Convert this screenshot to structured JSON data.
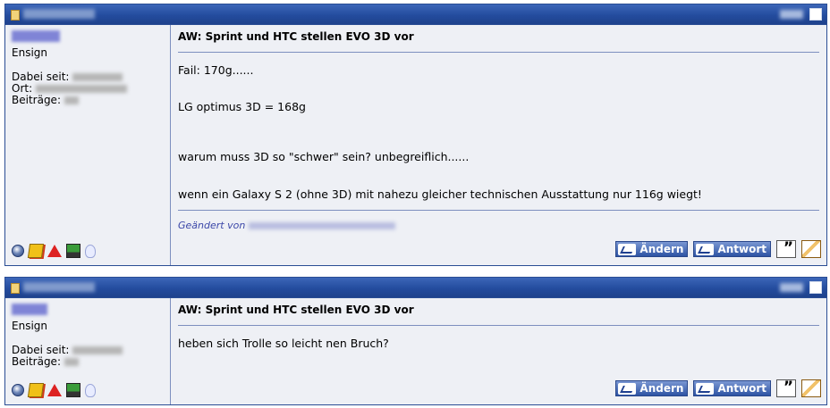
{
  "posts": [
    {
      "rank": "Ensign",
      "meta_labels": [
        "Dabei seit:",
        "Ort:",
        "Beiträge:"
      ],
      "title": "AW: Sprint und HTC stellen EVO 3D vor",
      "lines": [
        "Fail: 170g......",
        "LG optimus 3D = 168g",
        "warum muss 3D so \"schwer\" sein? unbegreiflich......",
        "wenn ein Galaxy S 2 (ohne 3D) mit nahezu gleicher technischen Ausstattung nur 116g wiegt!"
      ],
      "edited_prefix": "Geändert von",
      "buttons": {
        "edit": "Ändern",
        "reply": "Antwort"
      }
    },
    {
      "rank": "Ensign",
      "meta_labels": [
        "Dabei seit:",
        "Beiträge:"
      ],
      "title": "AW: Sprint und HTC stellen EVO 3D vor",
      "lines": [
        "heben sich Trolle so leicht nen Bruch?"
      ],
      "buttons": {
        "edit": "Ändern",
        "reply": "Antwort"
      }
    }
  ],
  "icons": [
    "globe-icon",
    "yellow-card-icon",
    "warning-icon",
    "computer-icon",
    "lightbulb-icon",
    "quote-icon",
    "edit-pencil-icon"
  ],
  "colors": {
    "header": "#244c9e",
    "panel": "#eef0f5",
    "border": "#2a4d94",
    "edited_text": "#3b47a8"
  }
}
